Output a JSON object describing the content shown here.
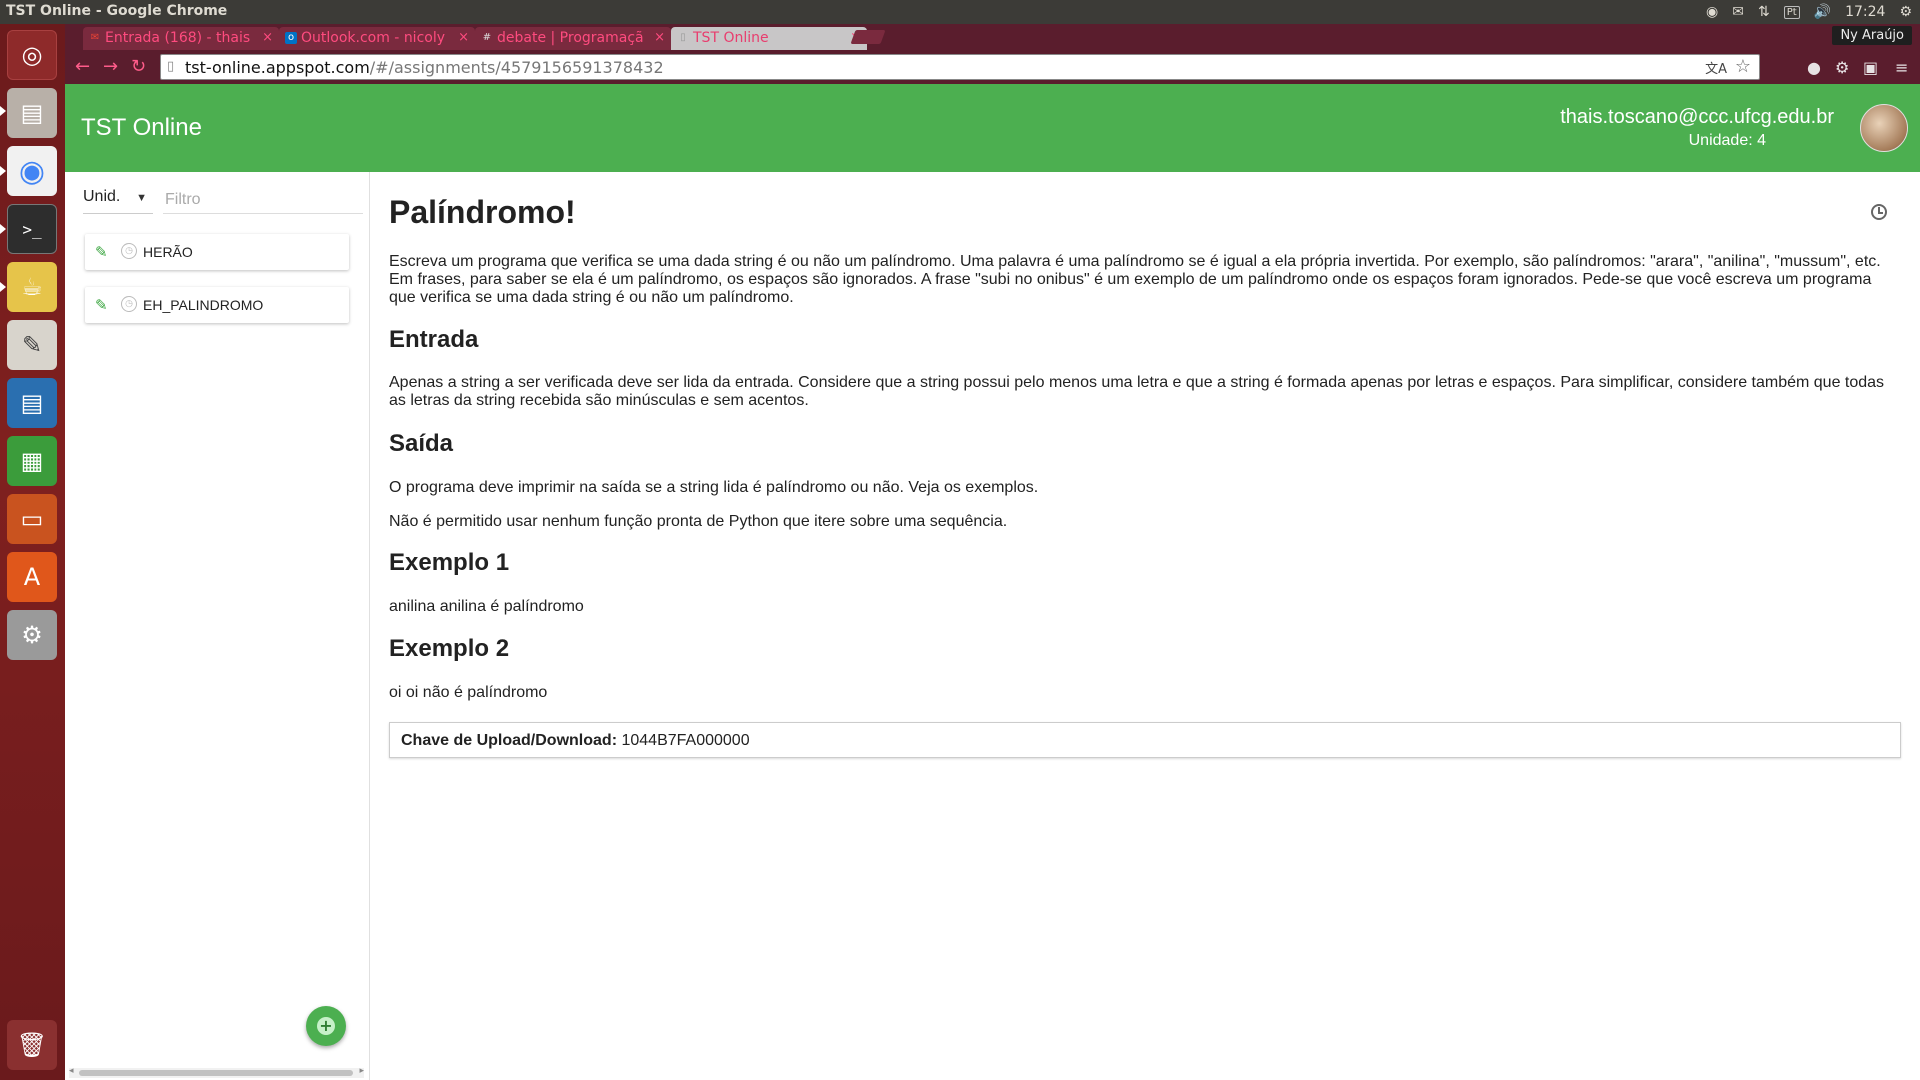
{
  "system": {
    "window_title": "TST Online - Google Chrome",
    "keyboard_layout": "Pt",
    "clock": "17:24"
  },
  "browser": {
    "tabs": [
      {
        "label": "Entrada (168) - thais",
        "icon": "gmail-icon"
      },
      {
        "label": "Outlook.com - nicoly",
        "icon": "outlook-icon"
      },
      {
        "label": "debate | Programaçã",
        "icon": "slack-icon"
      },
      {
        "label": "TST Online",
        "icon": "page-icon"
      }
    ],
    "profile_name": "Ny Araújo",
    "url_host": "tst-online.appspot.com",
    "url_path": "/#/assignments/4579156591378432"
  },
  "app": {
    "title": "TST Online",
    "user_email": "thais.toscano@ccc.ufcg.edu.br",
    "user_unit": "Unidade: 4"
  },
  "sidebar": {
    "unit_select": "Unid.",
    "filter_placeholder": "Filtro",
    "assignments": [
      {
        "label": "HERÃO"
      },
      {
        "label": "EH_PALINDROMO"
      }
    ]
  },
  "assignment": {
    "title": "Palíndromo!",
    "intro": "Escreva um programa que verifica se uma dada string é ou não um palíndromo. Uma palavra é uma palíndromo se é igual a ela própria invertida. Por exemplo, são palíndromos: \"arara\", \"anilina\", \"mussum\", etc. Em frases, para saber se ela é um palíndromo, os espaços são ignorados. A frase \"subi no onibus\" é um exemplo de um palíndromo onde os espaços foram ignorados. Pede-se que você escreva um programa que verifica se uma dada string é ou não um palíndromo.",
    "input_heading": "Entrada",
    "input_text": "Apenas a string a ser verificada deve ser lida da entrada. Considere que a string possui pelo menos uma letra e que a string é formada apenas por letras e espaços. Para simplificar, considere também que todas as letras da string recebida são minúsculas e sem acentos.",
    "output_heading": "Saída",
    "output_text_1": "O programa deve imprimir na saída se a string lida é palíndromo ou não. Veja os exemplos.",
    "output_text_2": "Não é permitido usar nenhum função pronta de Python que itere sobre uma sequência.",
    "example1_heading": "Exemplo 1",
    "example1_text": "anilina anilina é palíndromo",
    "example2_heading": "Exemplo 2",
    "example2_text": "oi oi não é palíndromo",
    "upload_key_label": "Chave de Upload/Download:",
    "upload_key_value": "1044B7FA000000"
  },
  "colors": {
    "header_green": "#4caf50",
    "chrome_frame": "#5a1d2d",
    "launcher": "#7a1f1e"
  }
}
